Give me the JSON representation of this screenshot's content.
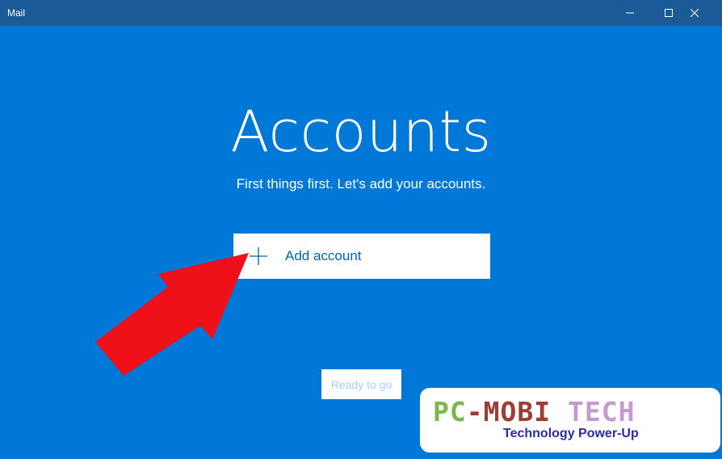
{
  "window": {
    "title": "Mail",
    "controls": [
      "minimize",
      "maximize",
      "close"
    ]
  },
  "main": {
    "heading": "Accounts",
    "subtitle": "First things first. Let's add your accounts.",
    "add_account_label": "Add account",
    "ready_label": "Ready to go"
  },
  "watermark": {
    "line1_a": "PC",
    "line1_b": "-MOBI",
    "line1_c": "TECH",
    "tagline": "Technology Power-Up"
  },
  "colors": {
    "background": "#0078d7",
    "titlebar": "#1a5a96",
    "accent_text": "#0063b1",
    "arrow": "#f0101a"
  },
  "icons": [
    "minimize-icon",
    "maximize-icon",
    "close-icon",
    "plus-icon",
    "arrow-annotation"
  ]
}
